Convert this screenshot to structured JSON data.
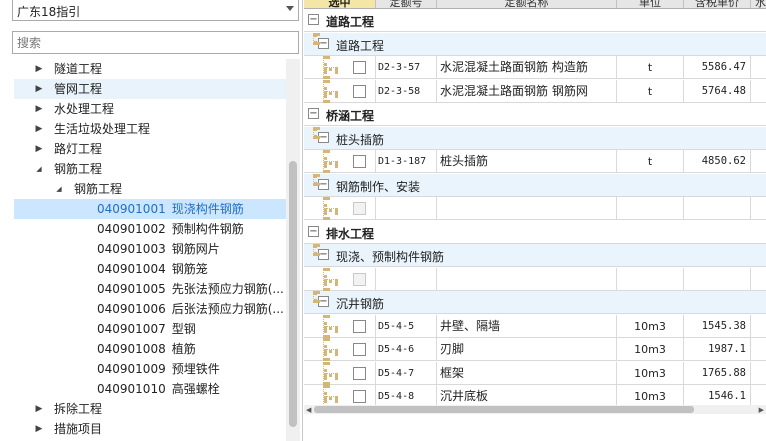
{
  "left": {
    "dropdown_value": "广东18指引",
    "search_placeholder": "搜索",
    "tree": [
      {
        "label": "隧道工程",
        "code": "",
        "arrow": "right"
      },
      {
        "label": "管网工程",
        "code": "",
        "arrow": "right",
        "hover": true
      },
      {
        "label": "水处理工程",
        "code": "",
        "arrow": "right"
      },
      {
        "label": "生活垃圾处理工程",
        "code": "",
        "arrow": "right"
      },
      {
        "label": "路灯工程",
        "code": "",
        "arrow": "right"
      },
      {
        "label": "钢筋工程",
        "code": "",
        "arrow": "down"
      },
      {
        "label": "钢筋工程",
        "code": "",
        "arrow": "down",
        "level": 2
      },
      {
        "label": "现浇构件钢筋",
        "code": "040901001",
        "selected": true,
        "level": 3
      },
      {
        "label": "预制构件钢筋",
        "code": "040901002",
        "level": 3
      },
      {
        "label": "钢筋网片",
        "code": "040901003",
        "level": 3
      },
      {
        "label": "钢筋笼",
        "code": "040901004",
        "level": 3
      },
      {
        "label": "先张法预应力钢筋(...",
        "code": "040901005",
        "level": 3
      },
      {
        "label": "后张法预应力钢筋(...",
        "code": "040901006",
        "level": 3
      },
      {
        "label": "型钢",
        "code": "040901007",
        "level": 3
      },
      {
        "label": "植筋",
        "code": "040901008",
        "level": 3
      },
      {
        "label": "预埋铁件",
        "code": "040901009",
        "level": 3
      },
      {
        "label": "高强螺栓",
        "code": "040901010",
        "level": 3
      },
      {
        "label": "拆除工程",
        "code": "",
        "arrow": "right"
      },
      {
        "label": "措施项目",
        "code": "",
        "arrow": "right"
      }
    ]
  },
  "table": {
    "headers": [
      "选中",
      "定额号",
      "定额名称",
      "单位",
      "含税单价",
      "水"
    ],
    "rows": [
      {
        "type": "group1",
        "label": "道路工程"
      },
      {
        "type": "group2",
        "label": "道路工程"
      },
      {
        "type": "item",
        "code": "D2-3-57",
        "name": "水泥混凝土路面钢筋 构造筋",
        "unit": "t",
        "price": "5586.47"
      },
      {
        "type": "item",
        "code": "D2-3-58",
        "name": "水泥混凝土路面钢筋 钢筋网",
        "unit": "t",
        "price": "5764.48"
      },
      {
        "type": "group1",
        "label": "桥涵工程"
      },
      {
        "type": "group2",
        "label": "桩头插筋"
      },
      {
        "type": "item",
        "code": "D1-3-187",
        "name": "桩头插筋",
        "unit": "t",
        "price": "4850.62"
      },
      {
        "type": "group2",
        "label": "钢筋制作、安装"
      },
      {
        "type": "empty"
      },
      {
        "type": "group1",
        "label": "排水工程"
      },
      {
        "type": "group2",
        "label": "现浇、预制构件钢筋"
      },
      {
        "type": "empty"
      },
      {
        "type": "group2",
        "label": "沉井钢筋"
      },
      {
        "type": "item",
        "code": "D5-4-5",
        "name": "井壁、隔墙",
        "unit": "10m3",
        "price": "1545.38"
      },
      {
        "type": "item",
        "code": "D5-4-6",
        "name": "刃脚",
        "unit": "10m3",
        "price": "1987.1"
      },
      {
        "type": "item",
        "code": "D5-4-7",
        "name": "框架",
        "unit": "10m3",
        "price": "1765.88"
      },
      {
        "type": "item",
        "code": "D5-4-8",
        "name": "沉井底板",
        "unit": "10m3",
        "price": "1546.1"
      }
    ]
  }
}
